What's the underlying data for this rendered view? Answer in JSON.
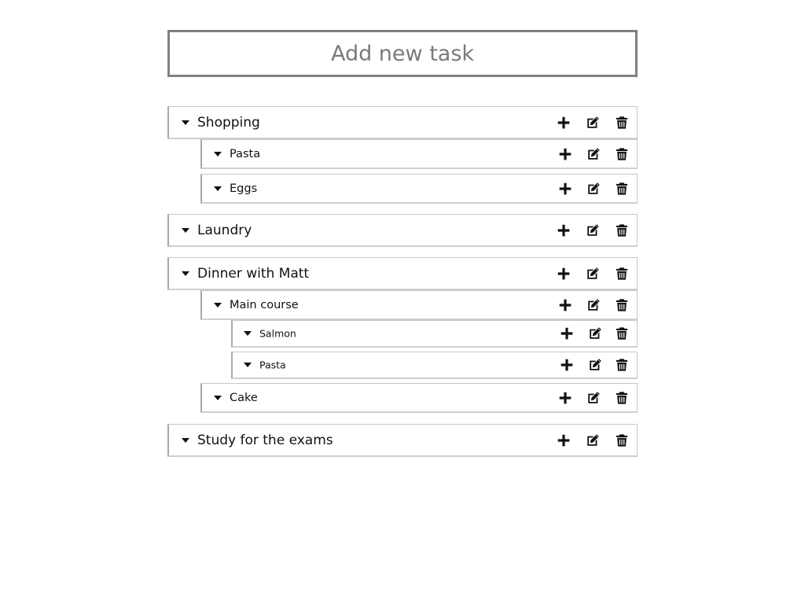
{
  "new_task": {
    "placeholder": "Add new task",
    "value": ""
  },
  "icons": {
    "expand": "caret-down-icon",
    "add": "plus-icon",
    "edit": "edit-icon",
    "delete": "trash-icon"
  },
  "colors": {
    "input_border": "#808080",
    "row_border": "#c8c8c8",
    "text": "#111111"
  },
  "tasks": [
    {
      "label": "Shopping",
      "children": [
        {
          "label": "Pasta",
          "children": []
        },
        {
          "label": "Eggs",
          "children": []
        }
      ]
    },
    {
      "label": "Laundry",
      "children": []
    },
    {
      "label": "Dinner with Matt",
      "children": [
        {
          "label": "Main course",
          "children": [
            {
              "label": "Salmon",
              "children": []
            },
            {
              "label": "Pasta",
              "children": []
            }
          ]
        },
        {
          "label": "Cake",
          "children": []
        }
      ]
    },
    {
      "label": "Study for the exams",
      "children": []
    }
  ]
}
